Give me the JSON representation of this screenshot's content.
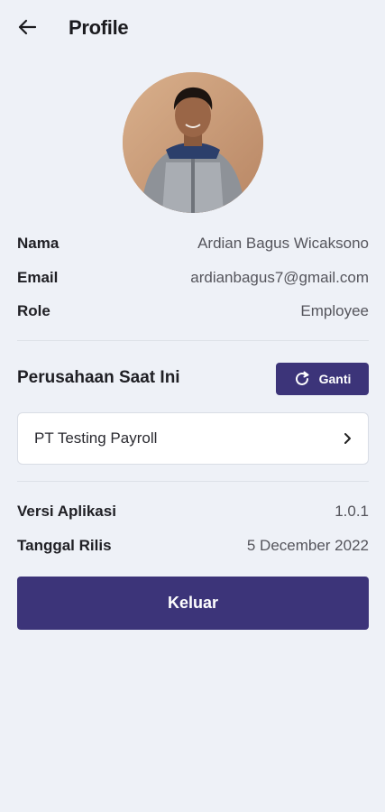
{
  "header": {
    "title": "Profile"
  },
  "profile": {
    "name_label": "Nama",
    "name_value": "Ardian Bagus Wicaksono",
    "email_label": "Email",
    "email_value": "ardianbagus7@gmail.com",
    "role_label": "Role",
    "role_value": "Employee"
  },
  "company": {
    "section_title": "Perusahaan Saat Ini",
    "change_label": "Ganti",
    "current_name": "PT Testing Payroll"
  },
  "app_info": {
    "version_label": "Versi Aplikasi",
    "version_value": "1.0.1",
    "release_label": "Tanggal Rilis",
    "release_value": "5 December 2022"
  },
  "actions": {
    "logout_label": "Keluar"
  },
  "icons": {
    "back": "arrow-left-icon",
    "refresh": "refresh-icon",
    "chevron": "chevron-right-icon"
  },
  "colors": {
    "primary": "#3c3479",
    "background": "#eef1f7"
  }
}
